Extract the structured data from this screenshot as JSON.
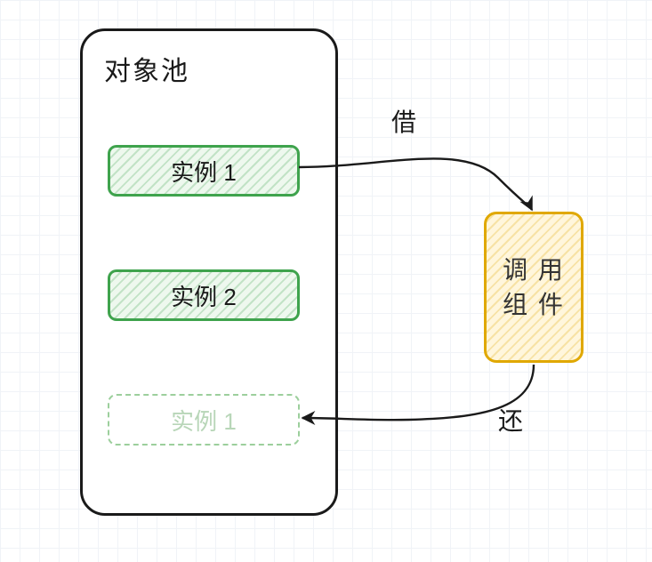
{
  "diagram": {
    "pool_title": "对象池",
    "instances": {
      "instance1": "实例 1",
      "instance2": "实例 2",
      "instance_ghost": "实例 1"
    },
    "caller_label_line1": "调 用",
    "caller_label_line2": "组 件",
    "edges": {
      "borrow": "借",
      "return": "还"
    }
  }
}
